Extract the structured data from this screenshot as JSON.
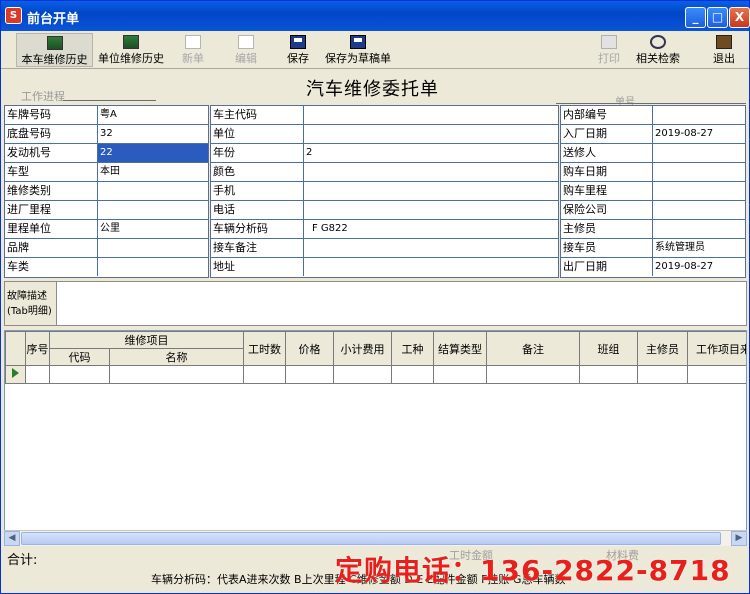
{
  "window": {
    "title": "前台开单",
    "controls": {
      "minimize": "_",
      "maximize": "□",
      "close": "X"
    }
  },
  "toolbar": {
    "vehicle_history": "本车维修历史",
    "unit_history": "单位维修历史",
    "new_order": "新单",
    "edit": "编辑",
    "save": "保存",
    "save_draft": "保存为草稿单",
    "print": "打印",
    "related_search": "相关检索",
    "exit": "退出"
  },
  "header": {
    "work_progress": "工作进程",
    "title": "汽车维修委托单",
    "order_no": "单号"
  },
  "left_fields": [
    {
      "label": "车牌号码",
      "value": "粤A"
    },
    {
      "label": "底盘号码",
      "value": "32"
    },
    {
      "label": "发动机号",
      "value": "22"
    },
    {
      "label": "车型",
      "value": "本田"
    },
    {
      "label": "维修类别",
      "value": ""
    },
    {
      "label": "进厂里程",
      "value": ""
    },
    {
      "label": "里程单位",
      "value": "公里"
    },
    {
      "label": "品牌",
      "value": ""
    },
    {
      "label": "车类",
      "value": ""
    }
  ],
  "middle_fields": [
    {
      "label": "车主代码",
      "value": ""
    },
    {
      "label": "单位",
      "value": ""
    },
    {
      "label": "年份",
      "value": "2"
    },
    {
      "label": "颜色",
      "value": ""
    },
    {
      "label": "手机",
      "value": ""
    },
    {
      "label": "电话",
      "value": ""
    },
    {
      "label": "车辆分析码",
      "value": "F G822"
    },
    {
      "label": "接车备注",
      "value": ""
    },
    {
      "label": "地址",
      "value": ""
    }
  ],
  "right_fields": [
    {
      "label": "内部编号",
      "value": ""
    },
    {
      "label": "入厂日期",
      "value": "2019-08-27"
    },
    {
      "label": "送修人",
      "value": ""
    },
    {
      "label": "购车日期",
      "value": ""
    },
    {
      "label": "购车里程",
      "value": ""
    },
    {
      "label": "保险公司",
      "value": ""
    },
    {
      "label": "主修员",
      "value": ""
    },
    {
      "label": "接车员",
      "value": "系统管理员"
    },
    {
      "label": "出厂日期",
      "value": "2019-08-27"
    }
  ],
  "fault": {
    "label_line1": "故障描述",
    "label_line2": "(Tab明细)",
    "value": ""
  },
  "items_table": {
    "seq": "序号",
    "repair_item": "维修项目",
    "code": "代码",
    "name": "名称",
    "work_hours": "工时数",
    "price": "价格",
    "subtotal": "小计费用",
    "work_type": "工种",
    "settle_type": "结算类型",
    "remarks": "备注",
    "team": "班组",
    "main_repairer": "主修员",
    "work_item": "工作项目来"
  },
  "footer": {
    "total": "合计:",
    "work_hours_amount": "工时金额",
    "material_fee": "材料费",
    "legend": "车辆分析码：代表A进来次数 B上次里程 C维修金额 D  E  E配件金额 F挂账 G总车辆数",
    "watermark": "定购电话：136-2822-8718"
  }
}
